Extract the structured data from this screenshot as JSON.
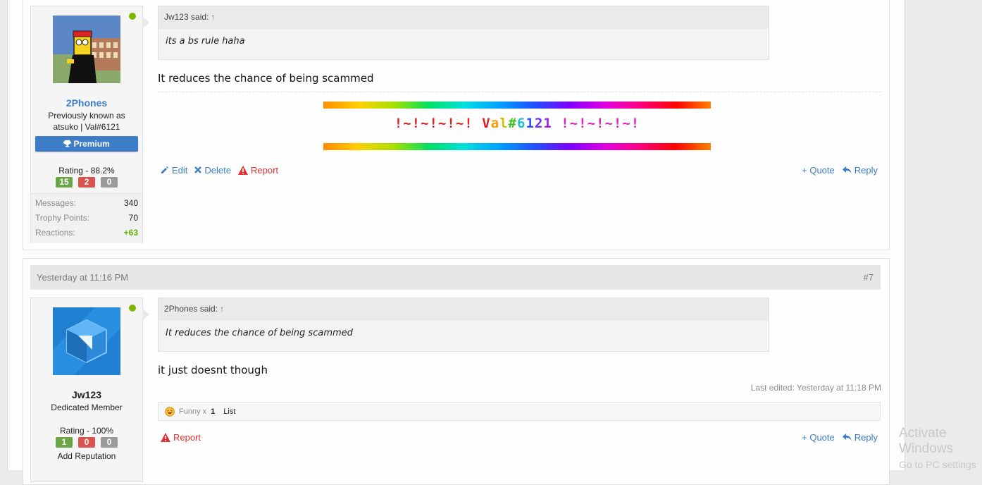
{
  "post1": {
    "user": {
      "name": "2Phones",
      "title": "Previously known as atsuko | Val#6121",
      "badge": "Premium",
      "rating_label": "Rating - 88.2%",
      "rating_pos": "15",
      "rating_neg": "2",
      "rating_neu": "0",
      "stats": [
        {
          "label": "Messages:",
          "value": "340"
        },
        {
          "label": "Trophy Points:",
          "value": "70"
        },
        {
          "label": "Reactions:",
          "value": "+63"
        }
      ]
    },
    "quote": {
      "author": "Jw123 said:",
      "arrow": "↑",
      "text": "its a bs rule haha"
    },
    "message": "It reduces the chance of being scammed",
    "signature": {
      "parts": [
        {
          "t": "!~!~!~!~! ",
          "c": "#e02020"
        },
        {
          "t": "V",
          "c": "#e02020"
        },
        {
          "t": "a",
          "c": "#ff9a00"
        },
        {
          "t": "l",
          "c": "#d0c000"
        },
        {
          "t": "#",
          "c": "#40c020"
        },
        {
          "t": "6",
          "c": "#20c0d0"
        },
        {
          "t": "1",
          "c": "#3050ff"
        },
        {
          "t": "2",
          "c": "#6a30ff"
        },
        {
          "t": "1",
          "c": "#a020f0"
        },
        {
          "t": " !~!~!~!~!",
          "c": "#e020c0"
        }
      ]
    },
    "actions": {
      "edit": "Edit",
      "delete": "Delete",
      "report": "Report",
      "quote": "+ Quote",
      "reply": "Reply"
    }
  },
  "post2": {
    "date": "Yesterday at 11:16 PM",
    "number": "#7",
    "user": {
      "name": "Jw123",
      "title": "Dedicated Member",
      "rating_label": "Rating - 100%",
      "rating_pos": "1",
      "rating_neg": "0",
      "rating_neu": "0",
      "add_rep": "Add Reputation"
    },
    "quote": {
      "author": "2Phones said:",
      "arrow": "↑",
      "text": "It reduces the chance of being scammed"
    },
    "message": "it just doesnt though",
    "last_edited": "Last edited: Yesterday at 11:18 PM",
    "reactions": {
      "label": "Funny x",
      "count": "1",
      "list": "List"
    },
    "actions": {
      "report": "Report",
      "quote": "+ Quote",
      "reply": "Reply"
    }
  },
  "watermark": {
    "line1": "Activate Windows",
    "line2": "Go to PC settings"
  },
  "colors": {
    "accent": "#3d7dc8",
    "online": "#7fb800",
    "report": "#e03030"
  }
}
